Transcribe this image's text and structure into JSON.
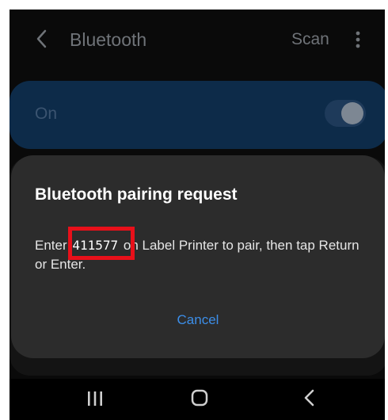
{
  "appbar": {
    "title": "Bluetooth",
    "scan_label": "Scan",
    "back_icon": "chevron-left-icon",
    "more_icon": "more-vert-icon"
  },
  "on_row": {
    "label": "On",
    "toggle_on": true
  },
  "dialog": {
    "title": "Bluetooth pairing request",
    "message_before": "Enter ",
    "pin": "411577",
    "message_after": " on Label Printer to pair, then tap Return or Enter.",
    "cancel_label": "Cancel"
  },
  "navbar": {
    "recents_icon": "recents-icon",
    "home_icon": "home-icon",
    "back_icon": "nav-back-icon"
  },
  "colors": {
    "accent": "#3c8ee8",
    "highlight": "#e8101a",
    "dialog_bg": "#2c2c2c"
  }
}
